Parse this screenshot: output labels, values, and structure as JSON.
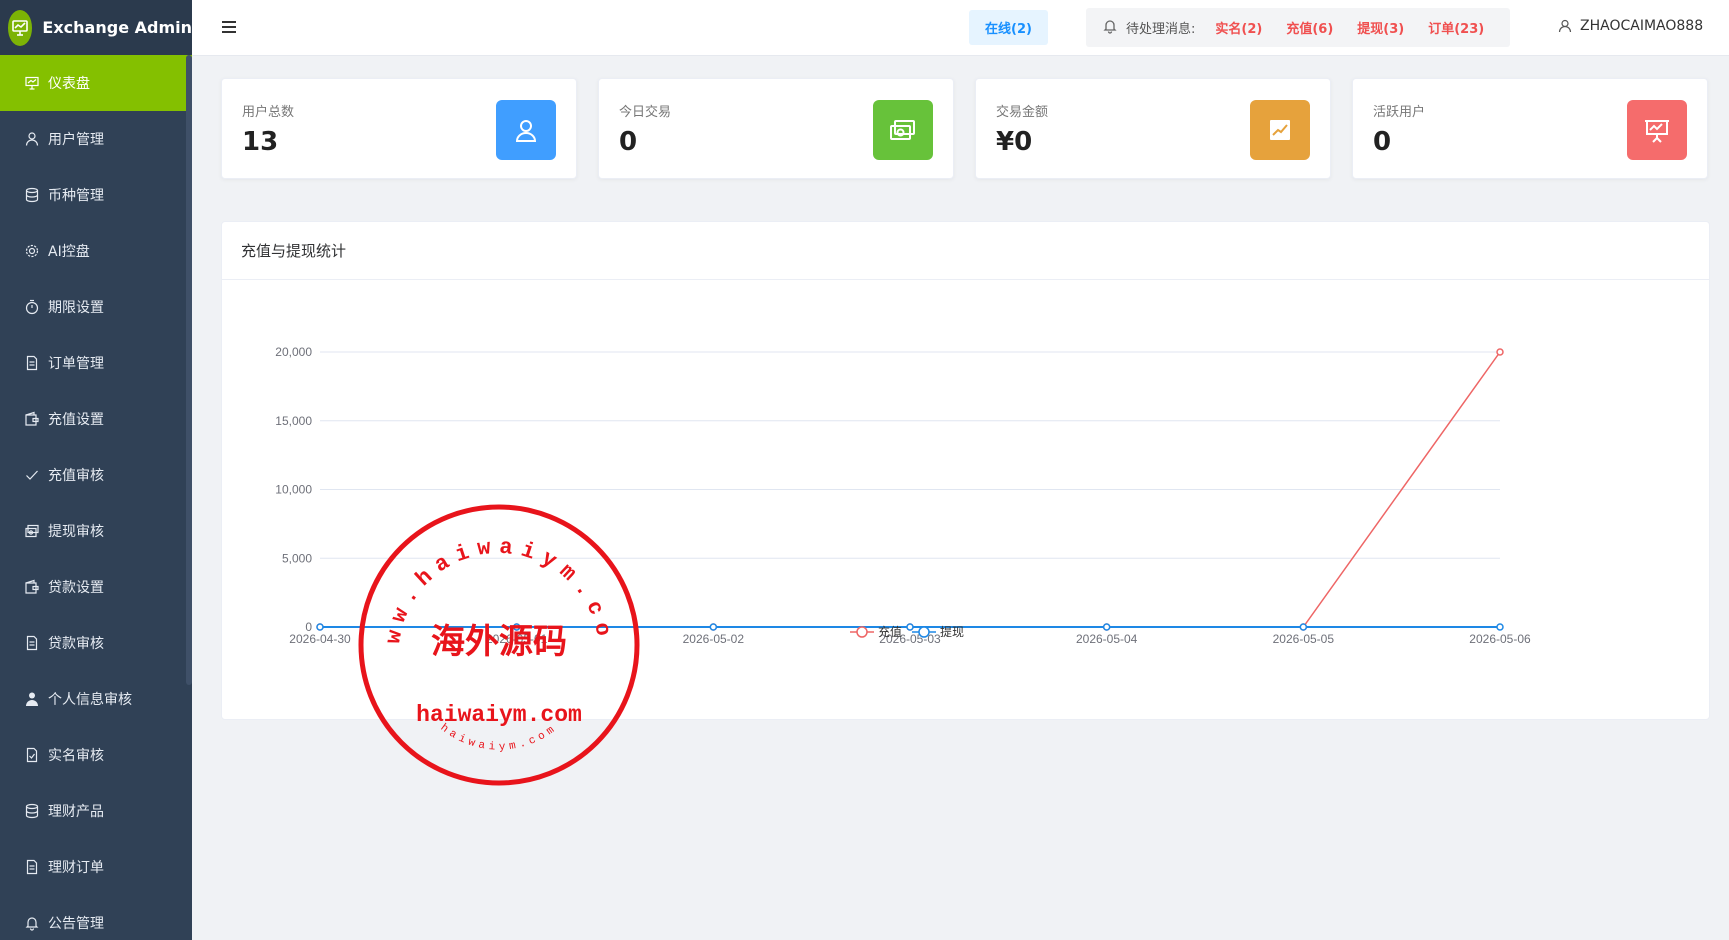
{
  "app": {
    "title": "Exchange Admin"
  },
  "sidebar": {
    "items": [
      {
        "label": "仪表盘",
        "icon": "dashboard-icon",
        "active": true
      },
      {
        "label": "用户管理",
        "icon": "user-icon"
      },
      {
        "label": "币种管理",
        "icon": "database-icon"
      },
      {
        "label": "AI控盘",
        "icon": "gear-icon"
      },
      {
        "label": "期限设置",
        "icon": "stopwatch-icon"
      },
      {
        "label": "订单管理",
        "icon": "document-icon"
      },
      {
        "label": "充值设置",
        "icon": "wallet-icon"
      },
      {
        "label": "充值审核",
        "icon": "check-icon"
      },
      {
        "label": "提现审核",
        "icon": "money-icon"
      },
      {
        "label": "贷款设置",
        "icon": "wallet-icon"
      },
      {
        "label": "贷款审核",
        "icon": "document-icon"
      },
      {
        "label": "个人信息审核",
        "icon": "person-solid-icon"
      },
      {
        "label": "实名审核",
        "icon": "document-check-icon"
      },
      {
        "label": "理财产品",
        "icon": "database-icon"
      },
      {
        "label": "理财订单",
        "icon": "document-icon"
      },
      {
        "label": "公告管理",
        "icon": "bell-icon"
      }
    ]
  },
  "header": {
    "online": "在线(2)",
    "notice_label": "待处理消息:",
    "notices": [
      "实名(2)",
      "充值(6)",
      "提现(3)",
      "订单(23)"
    ],
    "username": "ZHAOCAIMAO888"
  },
  "stats": [
    {
      "label": "用户总数",
      "value": "13",
      "color": "#409eff",
      "icon": "user-icon"
    },
    {
      "label": "今日交易",
      "value": "0",
      "color": "#67c23a",
      "icon": "money-icon"
    },
    {
      "label": "交易金额",
      "value": "¥0",
      "color": "#e6a23c",
      "icon": "trend-icon"
    },
    {
      "label": "活跃用户",
      "value": "0",
      "color": "#f56c6c",
      "icon": "presentation-icon"
    }
  ],
  "panel": {
    "title": "充值与提现统计"
  },
  "chart_data": {
    "type": "line",
    "categories": [
      "2026-04-30",
      "2026-05-01",
      "2026-05-02",
      "2026-05-03",
      "2026-05-04",
      "2026-05-05",
      "2026-05-06"
    ],
    "series": [
      {
        "name": "充值",
        "values": [
          0,
          0,
          0,
          0,
          0,
          0,
          20000
        ],
        "color": "#ee6666"
      },
      {
        "name": "提现",
        "values": [
          0,
          0,
          0,
          0,
          0,
          0,
          0
        ],
        "color": "#1e88e5"
      }
    ],
    "yticks": [
      "0",
      "5,000",
      "10,000",
      "15,000",
      "20,000"
    ],
    "ylim": [
      0,
      20000
    ],
    "legend": "bottom-center",
    "grid": true
  },
  "watermark": {
    "top_text": "www.haiwaiym.com",
    "center_text": "海外源码",
    "bottom_text": "haiwaiym.com",
    "ring_text": "haiwaiym.com",
    "color": "#e8141b"
  }
}
